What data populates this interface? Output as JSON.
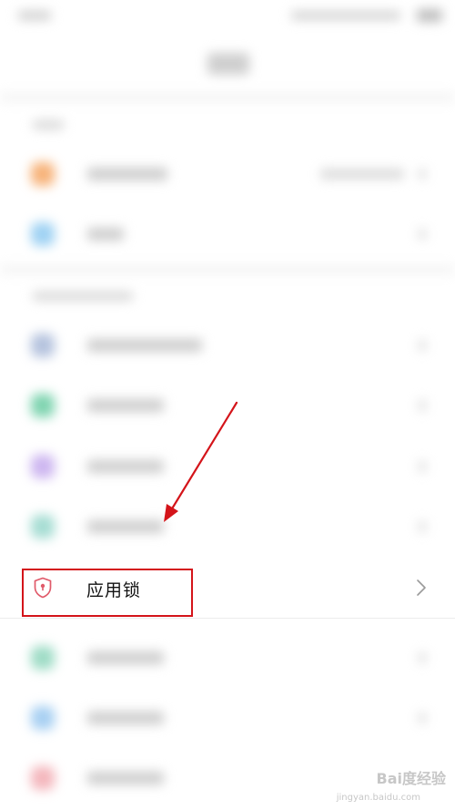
{
  "app_lock": {
    "label": "应用锁",
    "icon": "shield-lock-icon",
    "accent_color": "#e05a6a"
  },
  "annotation": {
    "box_color": "#d4141a"
  },
  "watermark": {
    "brand": "Bai度经验",
    "url": "jingyan.baidu.com"
  }
}
